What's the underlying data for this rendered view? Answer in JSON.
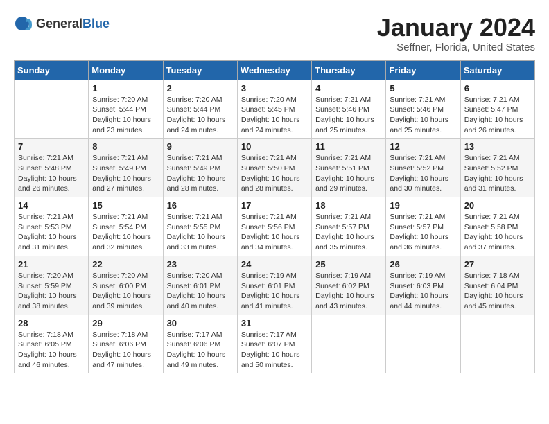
{
  "header": {
    "logo_general": "General",
    "logo_blue": "Blue",
    "title": "January 2024",
    "subtitle": "Seffner, Florida, United States"
  },
  "weekdays": [
    "Sunday",
    "Monday",
    "Tuesday",
    "Wednesday",
    "Thursday",
    "Friday",
    "Saturday"
  ],
  "weeks": [
    [
      {
        "day": "",
        "sunrise": "",
        "sunset": "",
        "daylight": ""
      },
      {
        "day": "1",
        "sunrise": "7:20 AM",
        "sunset": "5:44 PM",
        "daylight": "10 hours and 23 minutes."
      },
      {
        "day": "2",
        "sunrise": "7:20 AM",
        "sunset": "5:44 PM",
        "daylight": "10 hours and 24 minutes."
      },
      {
        "day": "3",
        "sunrise": "7:20 AM",
        "sunset": "5:45 PM",
        "daylight": "10 hours and 24 minutes."
      },
      {
        "day": "4",
        "sunrise": "7:21 AM",
        "sunset": "5:46 PM",
        "daylight": "10 hours and 25 minutes."
      },
      {
        "day": "5",
        "sunrise": "7:21 AM",
        "sunset": "5:46 PM",
        "daylight": "10 hours and 25 minutes."
      },
      {
        "day": "6",
        "sunrise": "7:21 AM",
        "sunset": "5:47 PM",
        "daylight": "10 hours and 26 minutes."
      }
    ],
    [
      {
        "day": "7",
        "sunrise": "7:21 AM",
        "sunset": "5:48 PM",
        "daylight": "10 hours and 26 minutes."
      },
      {
        "day": "8",
        "sunrise": "7:21 AM",
        "sunset": "5:49 PM",
        "daylight": "10 hours and 27 minutes."
      },
      {
        "day": "9",
        "sunrise": "7:21 AM",
        "sunset": "5:49 PM",
        "daylight": "10 hours and 28 minutes."
      },
      {
        "day": "10",
        "sunrise": "7:21 AM",
        "sunset": "5:50 PM",
        "daylight": "10 hours and 28 minutes."
      },
      {
        "day": "11",
        "sunrise": "7:21 AM",
        "sunset": "5:51 PM",
        "daylight": "10 hours and 29 minutes."
      },
      {
        "day": "12",
        "sunrise": "7:21 AM",
        "sunset": "5:52 PM",
        "daylight": "10 hours and 30 minutes."
      },
      {
        "day": "13",
        "sunrise": "7:21 AM",
        "sunset": "5:52 PM",
        "daylight": "10 hours and 31 minutes."
      }
    ],
    [
      {
        "day": "14",
        "sunrise": "7:21 AM",
        "sunset": "5:53 PM",
        "daylight": "10 hours and 31 minutes."
      },
      {
        "day": "15",
        "sunrise": "7:21 AM",
        "sunset": "5:54 PM",
        "daylight": "10 hours and 32 minutes."
      },
      {
        "day": "16",
        "sunrise": "7:21 AM",
        "sunset": "5:55 PM",
        "daylight": "10 hours and 33 minutes."
      },
      {
        "day": "17",
        "sunrise": "7:21 AM",
        "sunset": "5:56 PM",
        "daylight": "10 hours and 34 minutes."
      },
      {
        "day": "18",
        "sunrise": "7:21 AM",
        "sunset": "5:57 PM",
        "daylight": "10 hours and 35 minutes."
      },
      {
        "day": "19",
        "sunrise": "7:21 AM",
        "sunset": "5:57 PM",
        "daylight": "10 hours and 36 minutes."
      },
      {
        "day": "20",
        "sunrise": "7:21 AM",
        "sunset": "5:58 PM",
        "daylight": "10 hours and 37 minutes."
      }
    ],
    [
      {
        "day": "21",
        "sunrise": "7:20 AM",
        "sunset": "5:59 PM",
        "daylight": "10 hours and 38 minutes."
      },
      {
        "day": "22",
        "sunrise": "7:20 AM",
        "sunset": "6:00 PM",
        "daylight": "10 hours and 39 minutes."
      },
      {
        "day": "23",
        "sunrise": "7:20 AM",
        "sunset": "6:01 PM",
        "daylight": "10 hours and 40 minutes."
      },
      {
        "day": "24",
        "sunrise": "7:19 AM",
        "sunset": "6:01 PM",
        "daylight": "10 hours and 41 minutes."
      },
      {
        "day": "25",
        "sunrise": "7:19 AM",
        "sunset": "6:02 PM",
        "daylight": "10 hours and 43 minutes."
      },
      {
        "day": "26",
        "sunrise": "7:19 AM",
        "sunset": "6:03 PM",
        "daylight": "10 hours and 44 minutes."
      },
      {
        "day": "27",
        "sunrise": "7:18 AM",
        "sunset": "6:04 PM",
        "daylight": "10 hours and 45 minutes."
      }
    ],
    [
      {
        "day": "28",
        "sunrise": "7:18 AM",
        "sunset": "6:05 PM",
        "daylight": "10 hours and 46 minutes."
      },
      {
        "day": "29",
        "sunrise": "7:18 AM",
        "sunset": "6:06 PM",
        "daylight": "10 hours and 47 minutes."
      },
      {
        "day": "30",
        "sunrise": "7:17 AM",
        "sunset": "6:06 PM",
        "daylight": "10 hours and 49 minutes."
      },
      {
        "day": "31",
        "sunrise": "7:17 AM",
        "sunset": "6:07 PM",
        "daylight": "10 hours and 50 minutes."
      },
      {
        "day": "",
        "sunrise": "",
        "sunset": "",
        "daylight": ""
      },
      {
        "day": "",
        "sunrise": "",
        "sunset": "",
        "daylight": ""
      },
      {
        "day": "",
        "sunrise": "",
        "sunset": "",
        "daylight": ""
      }
    ]
  ]
}
